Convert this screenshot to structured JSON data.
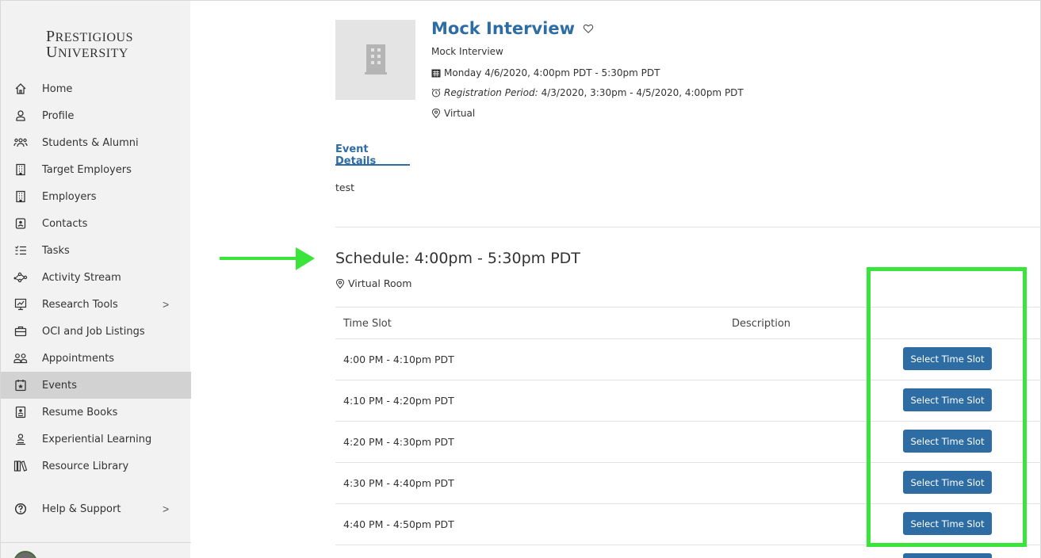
{
  "brand": {
    "line1": "Prestigious",
    "line2": "University"
  },
  "sidebar": {
    "items": [
      {
        "label": "Home",
        "icon": "home-icon"
      },
      {
        "label": "Profile",
        "icon": "user-icon"
      },
      {
        "label": "Students & Alumni",
        "icon": "users-icon"
      },
      {
        "label": "Target Employers",
        "icon": "building-icon"
      },
      {
        "label": "Employers",
        "icon": "building-icon"
      },
      {
        "label": "Contacts",
        "icon": "contact-card-icon"
      },
      {
        "label": "Tasks",
        "icon": "checklist-icon"
      },
      {
        "label": "Activity Stream",
        "icon": "network-icon"
      },
      {
        "label": "Research Tools",
        "icon": "chart-icon",
        "chevron": ">"
      },
      {
        "label": "OCI and Job Listings",
        "icon": "briefcase-icon"
      },
      {
        "label": "Appointments",
        "icon": "people-icon"
      },
      {
        "label": "Events",
        "icon": "calendar-star-icon",
        "active": true
      },
      {
        "label": "Resume Books",
        "icon": "resume-icon"
      },
      {
        "label": "Experiential Learning",
        "icon": "learning-icon"
      },
      {
        "label": "Resource Library",
        "icon": "library-icon"
      },
      {
        "label": "Help & Support",
        "icon": "help-icon",
        "chevron": ">"
      }
    ]
  },
  "event": {
    "title": "Mock Interview",
    "subtitle": "Mock Interview",
    "datetime": "Monday 4/6/2020, 4:00pm PDT - 5:30pm PDT",
    "registration_label": "Registration Period:",
    "registration_value": "4/3/2020, 3:30pm - 4/5/2020, 4:00pm PDT",
    "location": "Virtual"
  },
  "tabs": {
    "details": "Event Details"
  },
  "description": "test",
  "schedule": {
    "title": "Schedule: 4:00pm - 5:30pm PDT",
    "room": "Virtual Room",
    "headers": {
      "time_slot": "Time Slot",
      "description": "Description"
    },
    "slots": [
      {
        "time": "4:00 PM - 4:10pm PDT",
        "button": "Select Time Slot"
      },
      {
        "time": "4:10 PM - 4:20pm PDT",
        "button": "Select Time Slot"
      },
      {
        "time": "4:20 PM - 4:30pm PDT",
        "button": "Select Time Slot"
      },
      {
        "time": "4:30 PM - 4:40pm PDT",
        "button": "Select Time Slot"
      },
      {
        "time": "4:40 PM - 4:50pm PDT",
        "button": "Select Time Slot"
      }
    ]
  },
  "colors": {
    "accent": "#2e6da4",
    "highlight": "#39e53a",
    "sidebar_bg": "#f2f2f2",
    "active_bg": "#d2d2d2"
  }
}
